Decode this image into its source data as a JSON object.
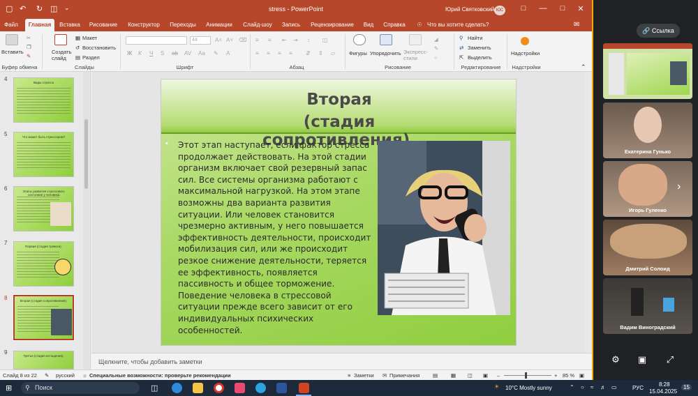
{
  "titlebar": {
    "title": "stress  -  PowerPoint",
    "user": "Юрий Святковский",
    "user_initials": "ЮС"
  },
  "tabs": [
    "Файл",
    "Главная",
    "Вставка",
    "Рисование",
    "Конструктор",
    "Переходы",
    "Анимации",
    "Слайд-шоу",
    "Запись",
    "Рецензирование",
    "Вид",
    "Справка"
  ],
  "tell_me": "Что вы хотите сделать?",
  "ribbon": {
    "paste": "Вставить",
    "clipboard": "Буфер обмена",
    "new_slide": "Создать слайд",
    "layout": "Макет",
    "reset": "Восстановить",
    "section": "Раздел",
    "slides": "Слайды",
    "font_size": "44",
    "font_group": "Шрифт",
    "paragraph_group": "Абзац",
    "shapes": "Фигуры",
    "arrange": "Упорядочить",
    "quick_styles": "Экспресс-стили",
    "drawing_group": "Рисование",
    "find": "Найти",
    "replace": "Заменить",
    "select": "Выделить",
    "editing_group": "Редактирование",
    "addins": "Надстройки",
    "addins_group": "Надстройки"
  },
  "thumbnails": [
    {
      "num": "4",
      "title": "Виды стресса"
    },
    {
      "num": "5",
      "title": "Что может быть стрессором?"
    },
    {
      "num": "6",
      "title": "Этапы развития стрессового состояния у человека"
    },
    {
      "num": "7",
      "title": "Первая (стадия тревоги)."
    },
    {
      "num": "8",
      "title": "Вторая (стадия сопротивления)."
    },
    {
      "num": "9",
      "title": "Третья (стадия истощения)."
    }
  ],
  "slide": {
    "title_line1": "Вторая",
    "title_line2": "(стадия сопротивления).",
    "body": "Этот этап наступает, если фактор стресса продолжает действовать. На этой стадии организм включает свой резервный запас сил. Все системы организма работают с максимальной нагрузкой. На этом этапе возможны два варианта развития ситуации. Или человек становится чрезмерно активным, у него повышается эффективность деятельности, происходит мобилизация сил, или же  происходит резкое снижение деятельности, теряется ее эффективность, появляется пассивность и общее торможение. Поведение человека в стрессовой ситуации прежде всего зависит от его индивидуальных психических особенностей."
  },
  "notes_placeholder": "Щелкните, чтобы добавить заметки",
  "status": {
    "slide_count": "Слайд 8 из 22",
    "language": "русский",
    "accessibility": "Специальные возможности: проверьте рекомендации",
    "notes": "Заметки",
    "comments": "Примечания",
    "zoom": "85 %"
  },
  "meeting": {
    "link_label": "Ссылка",
    "participants": [
      "Екатерина Гунько",
      "Игорь Гуленко",
      "Дмитрий Солоид",
      "Вадим Виноградский"
    ]
  },
  "taskbar": {
    "search": "Поиск",
    "weather": "10°C  Mostly sunny",
    "lang": "РУС",
    "time": "8:28",
    "date": "15.04.2025",
    "badge": "15"
  }
}
